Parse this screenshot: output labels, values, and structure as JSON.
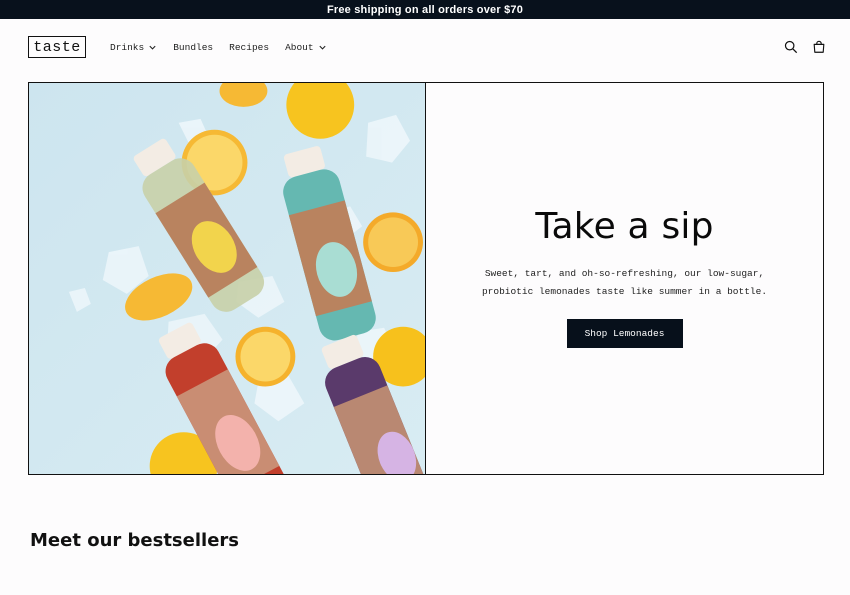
{
  "announcement": "Free shipping on all orders over $70",
  "logo": "taste",
  "nav": {
    "items": [
      {
        "label": "Drinks",
        "has_dropdown": true
      },
      {
        "label": "Bundles",
        "has_dropdown": false
      },
      {
        "label": "Recipes",
        "has_dropdown": false
      },
      {
        "label": "About",
        "has_dropdown": true
      }
    ]
  },
  "header_icons": [
    "search-icon",
    "cart-icon"
  ],
  "hero": {
    "title": "Take a sip",
    "description": "Sweet, tart, and oh-so-refreshing, our low-sugar, probiotic lemonades taste like summer in a bottle.",
    "button": "Shop Lemonades"
  },
  "section": {
    "title": "Meet our bestsellers"
  },
  "colors": {
    "announcement_bg": "#08111c",
    "button_bg": "#07101b",
    "hero_image_bg": "#cfe6ef"
  }
}
